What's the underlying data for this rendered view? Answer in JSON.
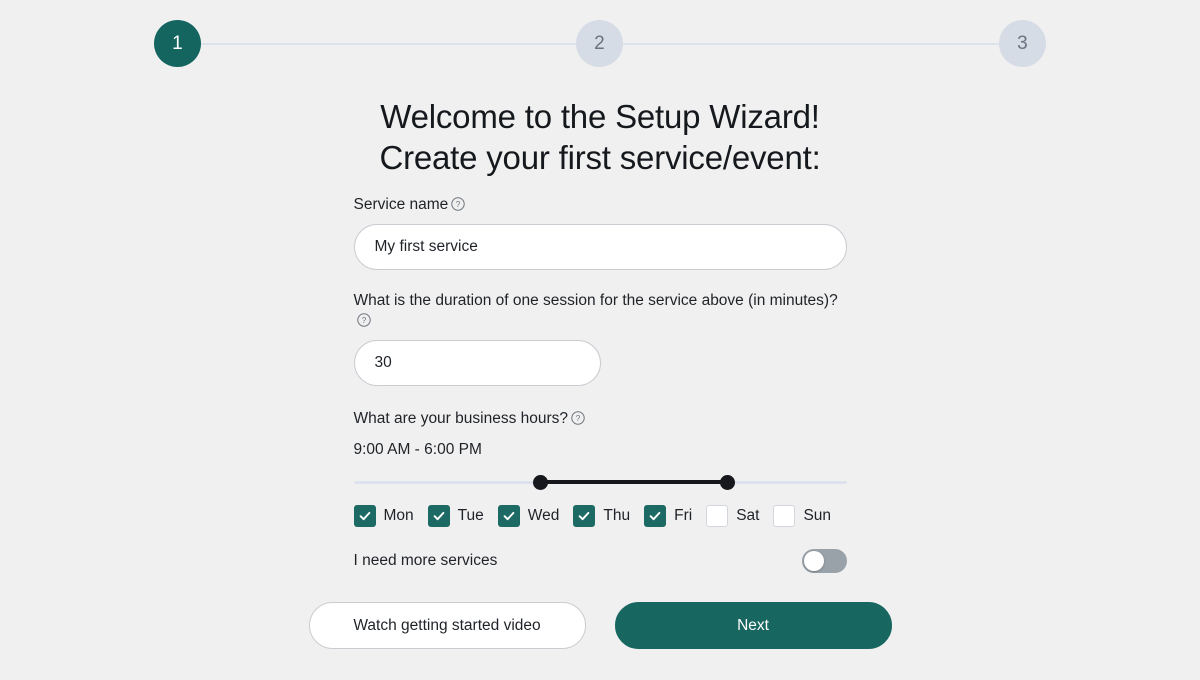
{
  "stepper": {
    "steps": [
      {
        "label": "1",
        "state": "active"
      },
      {
        "label": "2",
        "state": "inactive"
      },
      {
        "label": "3",
        "state": "inactive"
      }
    ]
  },
  "headline": {
    "line1": "Welcome to the Setup Wizard!",
    "line2": "Create your first service/event:"
  },
  "form": {
    "service_name": {
      "label": "Service name",
      "help_icon": "help-circle-icon",
      "value": "My first service",
      "placeholder": "Service name"
    },
    "duration": {
      "label": "What is the duration of one session for the service above (in minutes)?",
      "help_icon": "help-circle-icon",
      "value": "30",
      "placeholder": "30"
    },
    "business_hours": {
      "label": "What are your business hours?",
      "help_icon": "help-circle-icon",
      "value": "9:00 AM - 6:00 PM",
      "start_label": "9:00 AM",
      "end_label": "6:00 PM"
    },
    "days": [
      {
        "label": "Mon",
        "checked": true
      },
      {
        "label": "Tue",
        "checked": true
      },
      {
        "label": "Wed",
        "checked": true
      },
      {
        "label": "Thu",
        "checked": true
      },
      {
        "label": "Fri",
        "checked": true
      },
      {
        "label": "Sat",
        "checked": false
      },
      {
        "label": "Sun",
        "checked": false
      }
    ],
    "more_services": {
      "label": "I need more services",
      "enabled": false
    }
  },
  "actions": {
    "video_label": "Watch getting started video",
    "next_label": "Next"
  },
  "colors": {
    "brand_teal": "#186660",
    "checkbox_teal": "#1d6a64",
    "step_inactive": "#d6dce6",
    "page_background": "#f0f0f0",
    "track": "#dde3ec",
    "slider_fill": "#16181d"
  }
}
